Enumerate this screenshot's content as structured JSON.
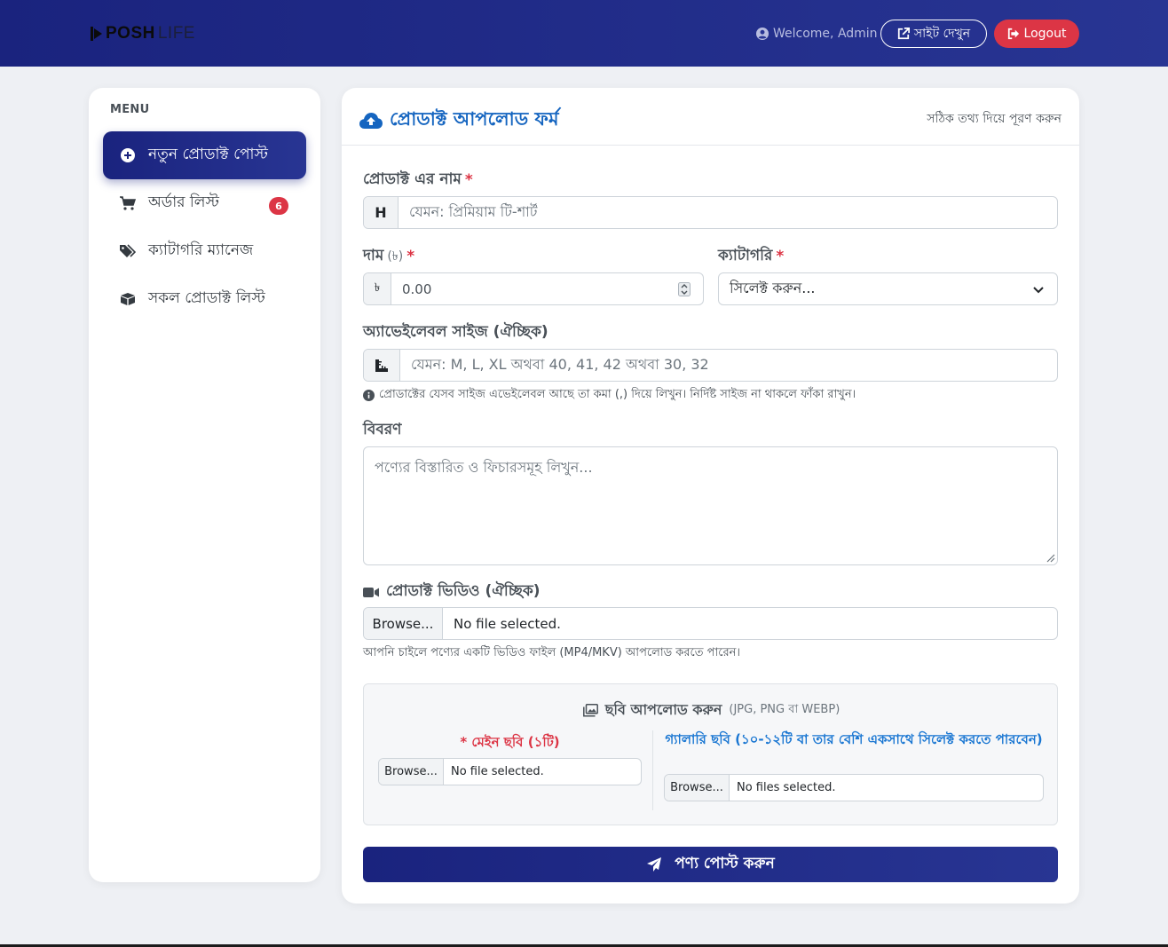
{
  "brand": {
    "part1": "POSH",
    "part2": "LIFE"
  },
  "header": {
    "welcome": "Welcome, Admin",
    "site_button": "সাইট দেখুন",
    "logout_button": "Logout"
  },
  "sidebar": {
    "title": "MENU",
    "items": [
      {
        "label": "নতুন প্রোডাক্ট পোস্ট",
        "icon": "plus-circle-icon",
        "active": true
      },
      {
        "label": "অর্ডার লিস্ট",
        "icon": "cart-icon",
        "badge": "6"
      },
      {
        "label": "ক্যাটাগরি ম্যানেজ",
        "icon": "tags-icon"
      },
      {
        "label": "সকল প্রোডাক্ট লিস্ট",
        "icon": "boxes-icon"
      }
    ]
  },
  "form": {
    "title": "প্রোডাক্ট আপলোড ফর্ম",
    "hint": "সঠিক তথ্য দিয়ে পূরণ করুন",
    "name_label": "প্রোডাক্ট এর নাম",
    "name_addon": "H",
    "name_placeholder": "যেমন: প্রিমিয়াম টি-শার্ট",
    "price_label": "দাম",
    "price_unit": "(৳)",
    "price_addon": "৳",
    "price_value": "0.00",
    "category_label": "ক্যাটাগরি",
    "category_value": "সিলেক্ট করুন...",
    "size_label": "অ্যাভেইলেবল সাইজ (ঐচ্ছিক)",
    "size_placeholder": "যেমন: M, L, XL অথবা 40, 41, 42 অথবা 30, 32",
    "size_help": "প্রোডাক্টের যেসব সাইজ এভেইলেবল আছে তা কমা (,) দিয়ে লিখুন। নির্দিষ্ট সাইজ না থাকলে ফাঁকা রাখুন।",
    "desc_label": "বিবরণ",
    "desc_placeholder": "পণ্যের বিস্তারিত ও ফিচারসমূহ লিখুন...",
    "video_label": "প্রোডাক্ট ভিডিও (ঐচ্ছিক)",
    "video_browse": "Browse...",
    "video_file": "No file selected.",
    "video_help": "আপনি চাইলে পণ্যের একটি ভিডিও ফাইল (MP4/MKV) আপলোড করতে পারেন।",
    "image_title": "ছবি আপলোড করুন",
    "image_formats": "(JPG, PNG বা WEBP)",
    "main_image_label": "* মেইন ছবি (১টি)",
    "main_browse": "Browse...",
    "main_file": "No file selected.",
    "gallery_label": "গ্যালারি ছবি (১০-১২টি বা তার বেশি একসাথে সিলেক্ট করতে পারবেন)",
    "gallery_browse": "Browse...",
    "gallery_file": "No files selected.",
    "submit": "পণ্য পোস্ট করুন"
  },
  "colors": {
    "primary": "#1a237e",
    "accent_blue": "#1565c0",
    "danger": "#dc3545"
  }
}
